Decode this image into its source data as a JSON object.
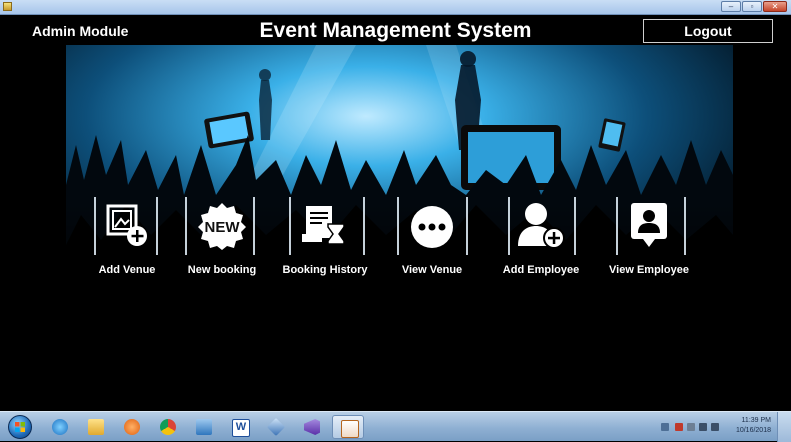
{
  "window": {
    "controls": {
      "minimize": "–",
      "maximize": "▫",
      "close": "✕"
    }
  },
  "header": {
    "module": "Admin Module",
    "title": "Event Management System",
    "logout_label": "Logout"
  },
  "menu": {
    "items": [
      {
        "label": "Add Venue",
        "icon": "add-venue-icon"
      },
      {
        "label": "New booking",
        "icon": "new-badge-icon"
      },
      {
        "label": "Booking History",
        "icon": "booking-history-icon"
      },
      {
        "label": "View Venue",
        "icon": "more-dots-icon"
      },
      {
        "label": "Add Employee",
        "icon": "add-person-icon"
      },
      {
        "label": "View Employee",
        "icon": "person-badge-icon"
      }
    ],
    "new_badge_text": "NEW"
  },
  "taskbar": {
    "apps": [
      "internet-explorer-icon",
      "file-explorer-icon",
      "media-player-icon",
      "chrome-icon",
      "media-center-icon",
      "word-icon",
      "virtualbox-icon",
      "visual-studio-icon",
      "java-app-icon"
    ],
    "clock_time": "11:39 PM",
    "clock_date": "10/16/2018"
  },
  "colors": {
    "background": "#000000",
    "text": "#ffffff",
    "banner_glow": "#3ab0e8"
  }
}
